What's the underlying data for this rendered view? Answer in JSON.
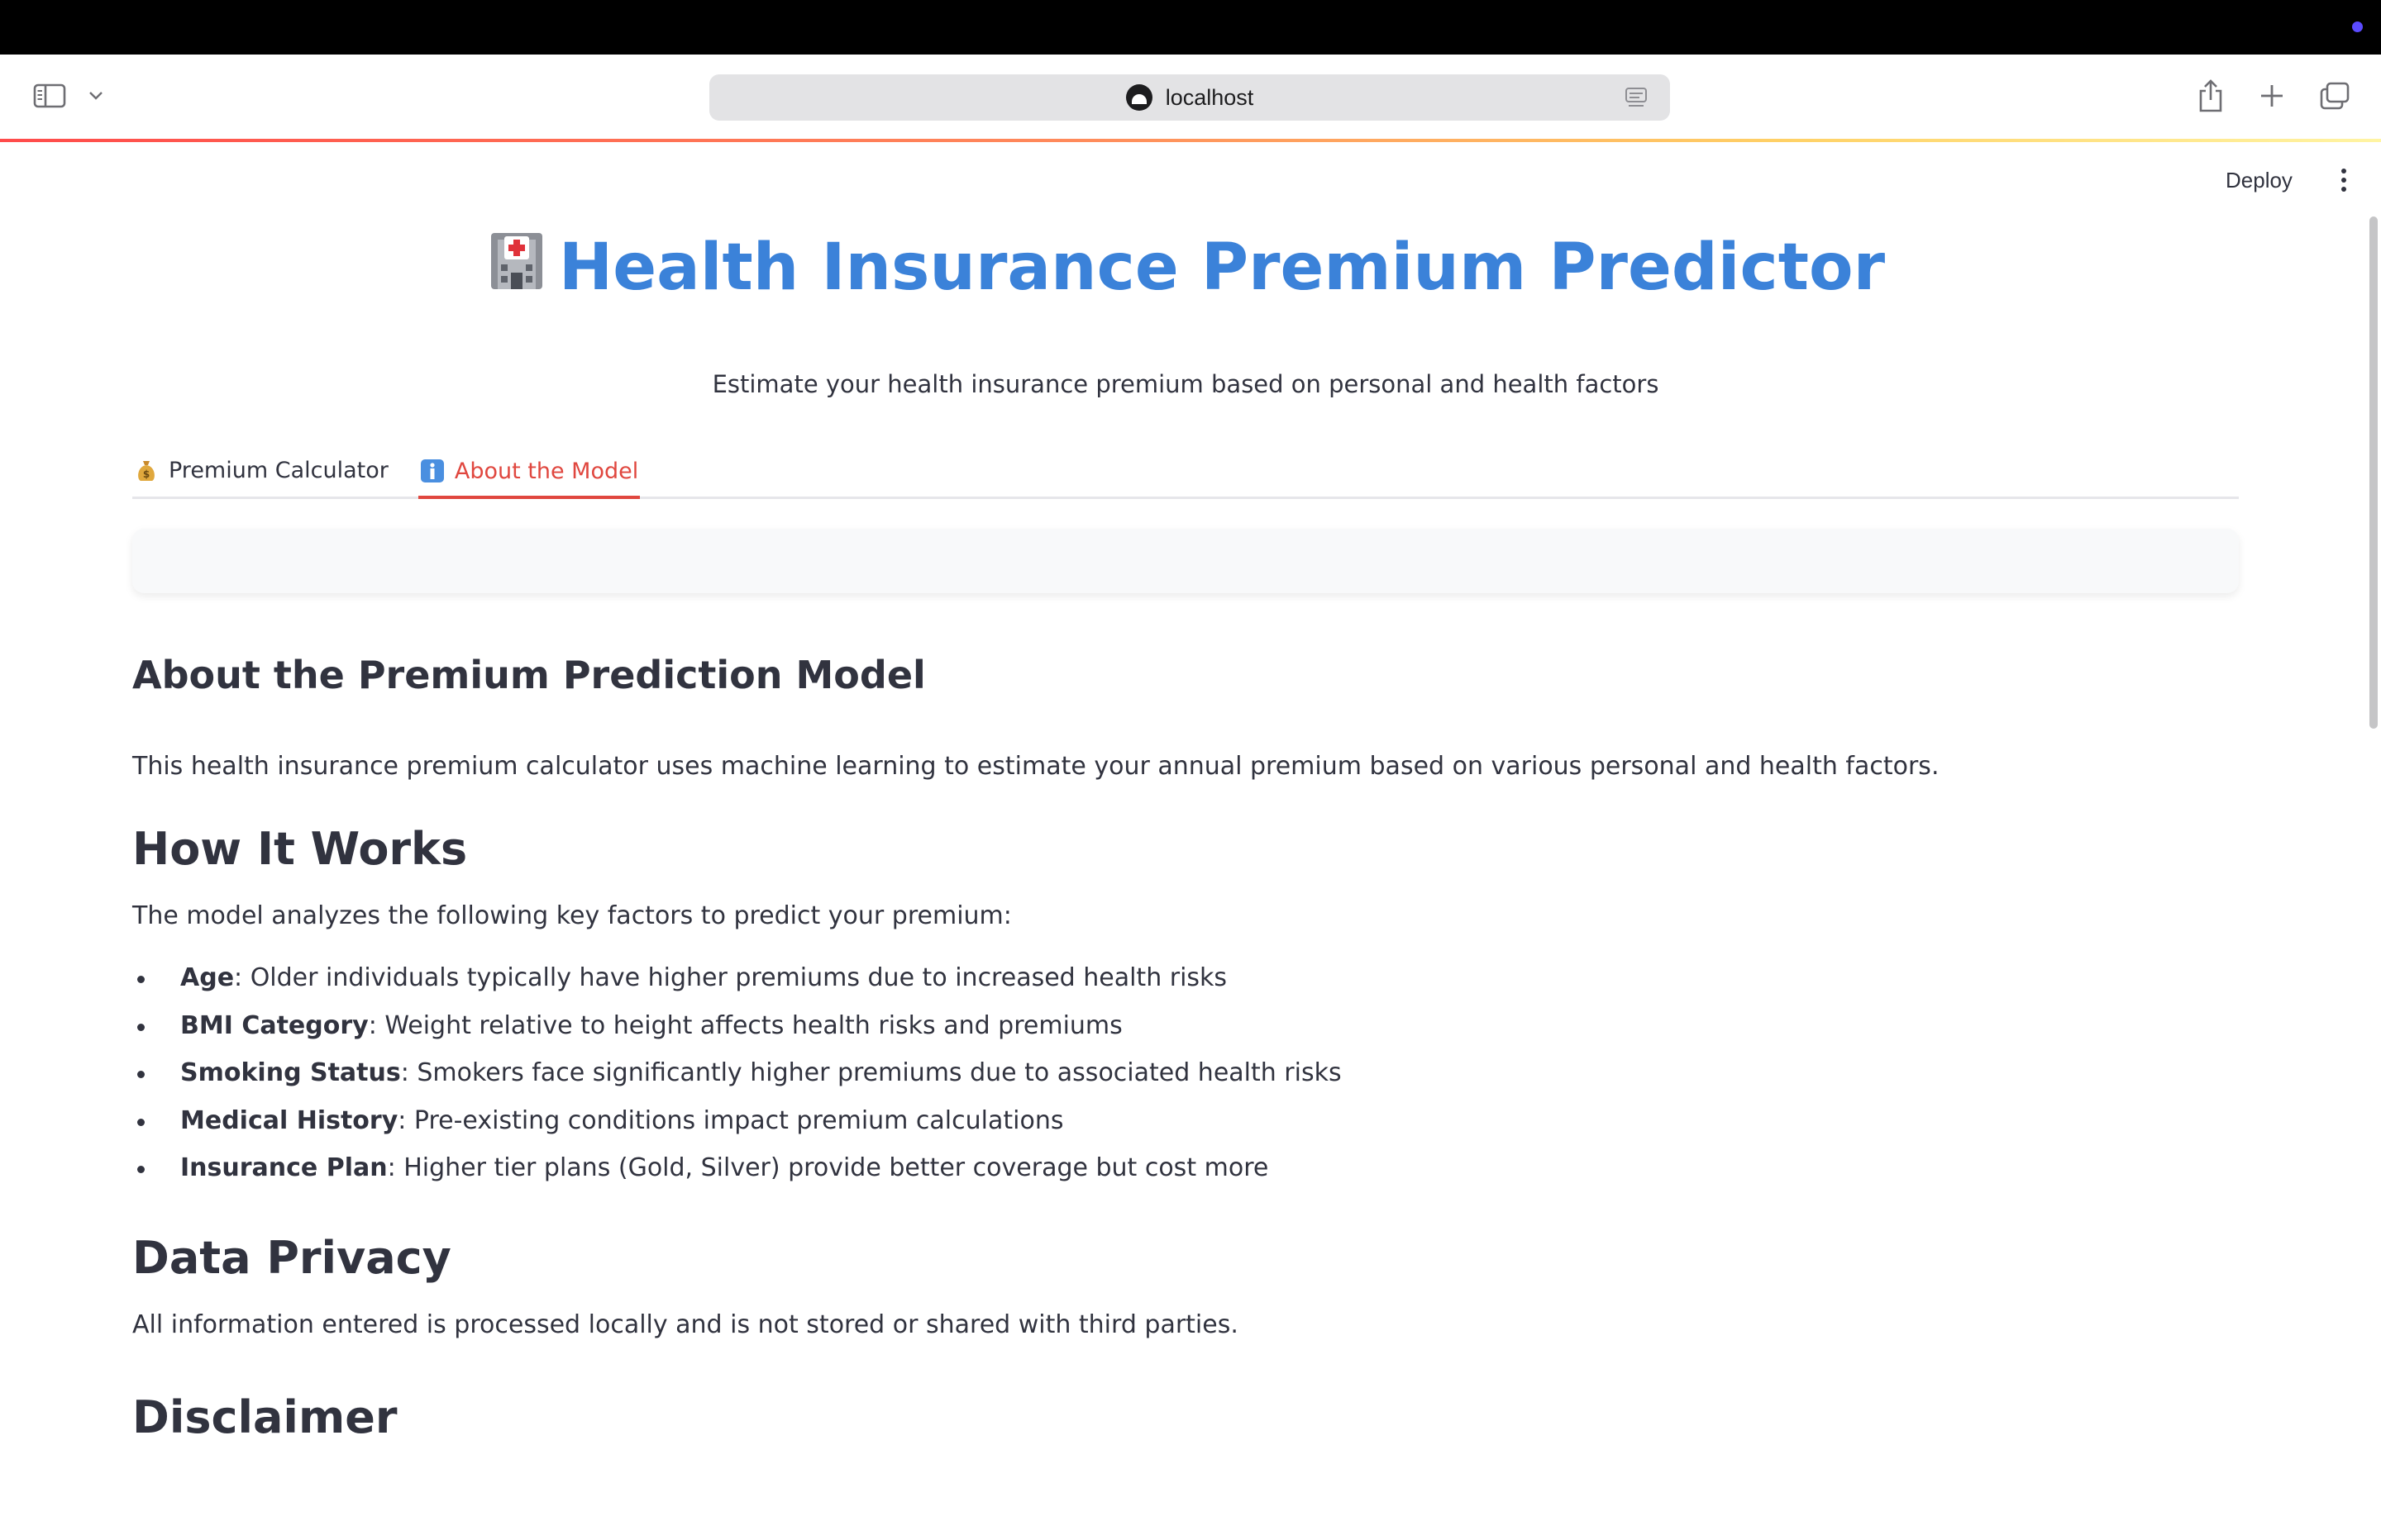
{
  "browser": {
    "url": "localhost"
  },
  "app_header": {
    "deploy_label": "Deploy"
  },
  "page": {
    "title": "Health Insurance Premium Predictor",
    "subtitle": "Estimate your health insurance premium based on personal and health factors"
  },
  "tabs": [
    {
      "icon": "money-bag-icon",
      "label": "Premium Calculator",
      "active": false
    },
    {
      "icon": "info-icon",
      "label": "About the Model",
      "active": true
    }
  ],
  "about": {
    "heading": "About the Premium Prediction Model",
    "intro": "This health insurance premium calculator uses machine learning to estimate your annual premium based on various personal and health factors.",
    "how_heading": "How It Works",
    "how_intro": "The model analyzes the following key factors to predict your premium:",
    "factors": [
      {
        "name": "Age",
        "desc": ": Older individuals typically have higher premiums due to increased health risks"
      },
      {
        "name": "BMI Category",
        "desc": ": Weight relative to height affects health risks and premiums"
      },
      {
        "name": "Smoking Status",
        "desc": ": Smokers face significantly higher premiums due to associated health risks"
      },
      {
        "name": "Medical History",
        "desc": ": Pre-existing conditions impact premium calculations"
      },
      {
        "name": "Insurance Plan",
        "desc": ": Higher tier plans (Gold, Silver) provide better coverage but cost more"
      }
    ],
    "privacy_heading": "Data Privacy",
    "privacy_text": "All information entered is processed locally and is not stored or shared with third parties.",
    "disclaimer_heading": "Disclaimer"
  },
  "colors": {
    "title": "#3b82d9",
    "active_tab": "#e0473f",
    "text": "#31333f"
  }
}
